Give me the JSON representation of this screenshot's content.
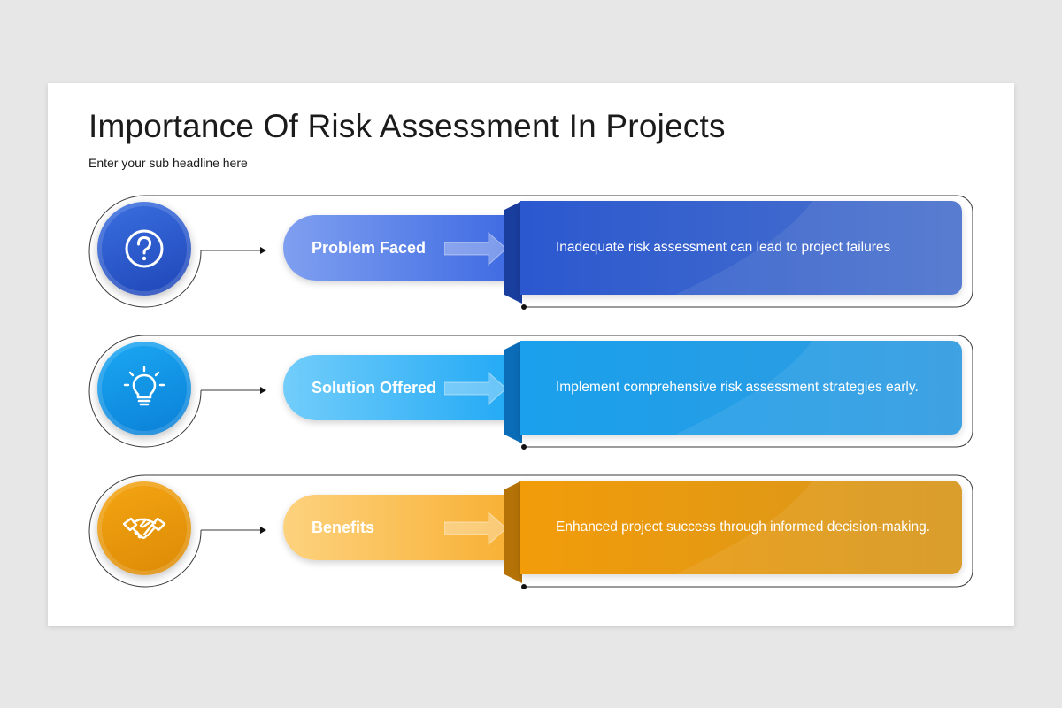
{
  "title": "Importance Of Risk Assessment In Projects",
  "subtitle": "Enter your sub headline here",
  "rows": [
    {
      "label": "Problem Faced",
      "description": "Inadequate risk assessment can lead to project failures",
      "icon": "question-icon",
      "colors": {
        "circle_light": "#3a6fe0",
        "circle_dark": "#1f46b8",
        "pill_light": "#7f9ff0",
        "pill_dark": "#3563e0",
        "box_light": "#2b58cf",
        "box_dark": "#4a72cc",
        "fold": "#1a3e9e"
      }
    },
    {
      "label": "Solution Offered",
      "description": "Implement comprehensive risk assessment strategies early.",
      "icon": "lightbulb-icon",
      "colors": {
        "circle_light": "#1ba8f4",
        "circle_dark": "#0a7fd6",
        "pill_light": "#72cdfa",
        "pill_dark": "#16a4f4",
        "box_light": "#1aa0ec",
        "box_dark": "#2f9be0",
        "fold": "#0b6cb8"
      }
    },
    {
      "label": "Benefits",
      "description": "Enhanced project success through informed decision-making.",
      "icon": "handshake-icon",
      "colors": {
        "circle_light": "#f4a512",
        "circle_dark": "#dc8a06",
        "pill_light": "#fdd27e",
        "pill_dark": "#f7ab28",
        "box_light": "#f29c0a",
        "box_dark": "#d6961c",
        "fold": "#b57307"
      }
    }
  ]
}
